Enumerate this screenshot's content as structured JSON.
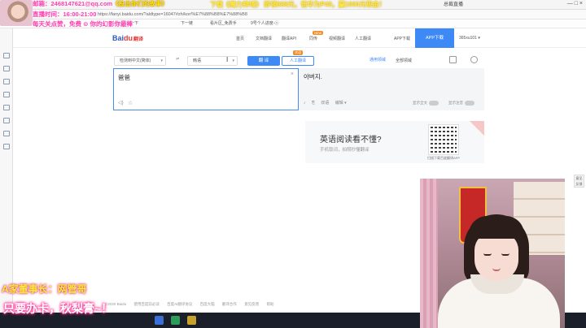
{
  "browser": {
    "ad_text": "下载《魔力神域》  即领888元，悟华为P40，赢1000元现金！",
    "user": "总裁直播",
    "win_controls": "— □ ×",
    "nav": "◀ ▶ ⟳ ⌂",
    "url": "https://fanyi.baidu.com/?aldtype=16047#zh/kor/%E7%88%B8%E7%88%B8",
    "bookmarks": [
      "百度一下",
      "下一链",
      "看片区_免费手",
      "9号个人进度-ⓧ"
    ]
  },
  "topnav": {
    "logo_main": "Bai",
    "logo_accent": "du",
    "logo_suffix": "翻译",
    "items": [
      "首页",
      "文档翻译",
      "翻译API",
      "同传",
      "视频翻译",
      "人工翻译",
      "APP下载",
      "百度AI"
    ],
    "new_badge": "NEW",
    "download_btn": "APP下载",
    "user": "365xu101 ▾"
  },
  "langbar": {
    "source_lang": "检测到中文(简体)",
    "swap": "⇌",
    "target_lang": "韩语",
    "translate_btn": "翻 译",
    "human_btn": "人工翻译",
    "term_tag": "术语",
    "domain_label": "通用领域",
    "domain_sel": "全部领域"
  },
  "source": {
    "text": "爸爸",
    "clear": "×"
  },
  "target": {
    "text": "아버지.",
    "tools": [
      "♪",
      "⎘",
      "双语",
      "编辑 ▾"
    ],
    "toggle1": "显示全文",
    "toggle2": "显示注音"
  },
  "promo": {
    "headline": "英语阅读看不懂?",
    "sub": "手机取词，拍照秒懂翻译",
    "qr_caption": "扫描下载百度翻译APP"
  },
  "footer": [
    "©2020 Baidu",
    "使用百度前必读",
    "百度AI翻译协议",
    "百度大脑",
    "翻译合作",
    "意见反馈",
    "帮助"
  ],
  "right_float": "意见反馈",
  "overlay": {
    "line1_a": "邮箱：2468147621@qq.com",
    "line1_b": "《投出你们的故事》",
    "line2": "直播时间：16:00-21:00",
    "line3": "每天关点赞，免费 ⊙ 你的幻影你最棒",
    "line4": "A家董事长：网管哥",
    "line5": "只要办卡，秋梨膏~！"
  }
}
